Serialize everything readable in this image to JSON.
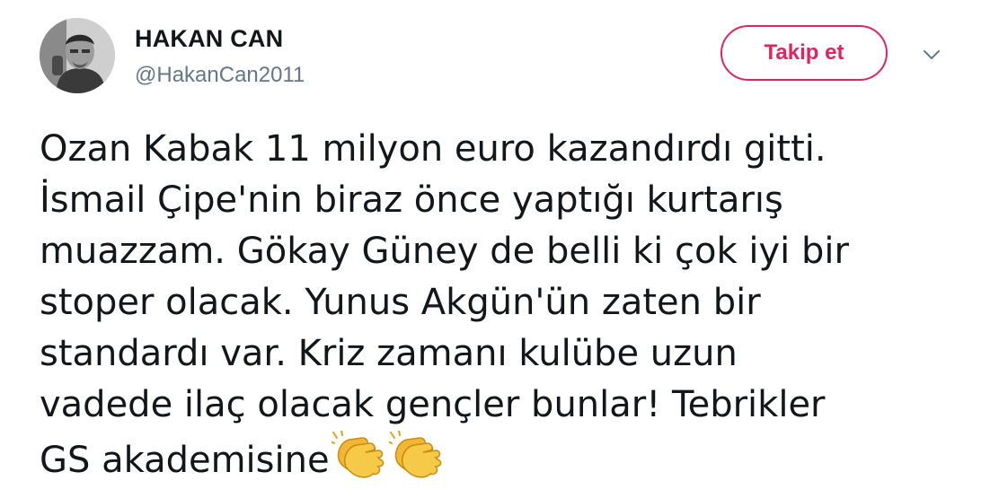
{
  "user": {
    "display_name": "HAKAN CAN",
    "handle": "@HakanCan2011"
  },
  "actions": {
    "follow_label": "Takip et",
    "follow_color": "#e0245e",
    "more_icon": "chevron-down-icon"
  },
  "tweet": {
    "lines": [
      "Ozan Kabak 11 milyon euro kazandırdı gitti.",
      "İsmail Çipe'nin biraz önce yaptığı kurtarış",
      "muazzam. Gökay Güney de belli ki çok iyi bir",
      "stoper olacak. Yunus Akgün'ün zaten bir",
      "standardı var. Kriz zamanı kulübe uzun",
      "vadede ilaç olacak gençler bunlar! Tebrikler",
      "GS akademisine"
    ],
    "emojis": [
      "clapping-hands-emoji",
      "clapping-hands-emoji"
    ]
  }
}
